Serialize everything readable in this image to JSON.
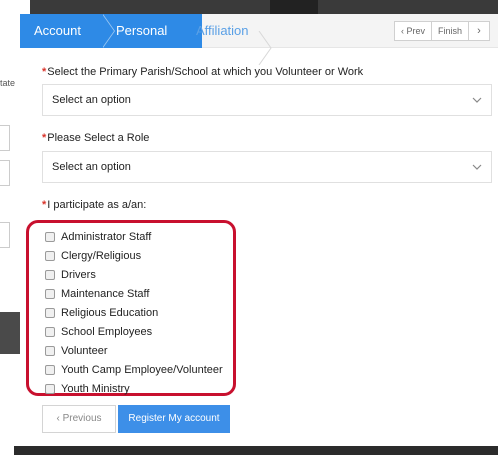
{
  "background": {
    "fragment_text": "tate"
  },
  "steps": [
    {
      "label": "Account"
    },
    {
      "label": "Personal"
    },
    {
      "label": "Affiliation"
    }
  ],
  "nav": {
    "prev_label": "‹ Prev",
    "finish_label": "Finish",
    "close_label": "›"
  },
  "form": {
    "parish": {
      "required_mark": "*",
      "label": "Select the Primary Parish/School at which you Volunteer or Work",
      "value": "Select an option"
    },
    "role": {
      "required_mark": "*",
      "label": "Please Select a Role",
      "value": "Select an option"
    },
    "participate": {
      "required_mark": "*",
      "label": "I participate as a/an:",
      "options": [
        "Administrator Staff",
        "Clergy/Religious",
        "Drivers",
        "Maintenance Staff",
        "Religious Education",
        "School Employees",
        "Volunteer",
        "Youth Camp Employee/Volunteer",
        "Youth Ministry"
      ]
    }
  },
  "buttons": {
    "previous_label": "‹  Previous",
    "register_label": "Register My account"
  },
  "colors": {
    "accent": "#2e8ae6",
    "highlight_border": "#c8102e",
    "required": "#d9342b"
  }
}
